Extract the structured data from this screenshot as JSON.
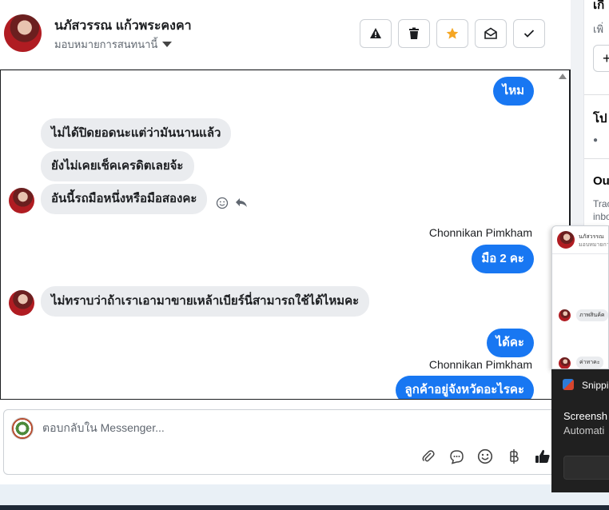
{
  "header": {
    "contact_name": "นภัสวรรณ แก้วพระคงคา",
    "assign_label": "มอบหมายการสนทนานี้",
    "buttons": [
      {
        "name": "spam",
        "icon": "warning-icon"
      },
      {
        "name": "delete",
        "icon": "trash-icon"
      },
      {
        "name": "star",
        "icon": "star-icon"
      },
      {
        "name": "mark-unread",
        "icon": "envelope-open-icon"
      },
      {
        "name": "done",
        "icon": "check-icon"
      }
    ]
  },
  "conversation": {
    "messages": [
      {
        "dir": "out",
        "text": "ไหม"
      },
      {
        "dir": "in",
        "text": "ไม่ได้ปิดยอดนะแต่ว่ามันนานแล้ว"
      },
      {
        "dir": "in",
        "text": "ยังไม่เคยเช็คเครดิตเลยจ้ะ"
      },
      {
        "dir": "in",
        "text": "อันนี้รถมือหนึ่งหรือมือสองคะ"
      },
      {
        "dir": "out",
        "sender": "Chonnikan Pimkham",
        "text": "มือ 2 คะ"
      },
      {
        "dir": "in",
        "text": "ไม่ทราบว่าถ้าเราเอามาขายเหล้าเบียร์นี่สามารถใช้ได้ไหมคะ"
      },
      {
        "dir": "out",
        "text": "ได้คะ"
      },
      {
        "dir": "out",
        "sender": "Chonnikan Pimkham",
        "text": "ลูกค้าอยู่จังหวัดอะไรคะ"
      }
    ]
  },
  "composer": {
    "placeholder": "ตอบกลับใน Messenger...",
    "icons": [
      "paperclip-icon",
      "saved-reply-icon",
      "emoji-icon",
      "baht-icon",
      "thumbs-up-icon"
    ]
  },
  "right_panel": {
    "texts": [
      "เกี",
      "เพิ่",
      "+",
      "โป",
      "Ou",
      "Trac",
      "inbo"
    ]
  },
  "popup": {
    "line1": "นภัสวรรณ",
    "line2": "มอบหมายกา",
    "msg1": "ภาพสินค้ค",
    "msg2": "ค่าทาคะ"
  },
  "toast": {
    "app": "Snippi",
    "title": "Screensh",
    "subtitle": "Automati"
  },
  "colors": {
    "accent": "#1877f2",
    "incoming_bubble": "#eaecef",
    "star": "#f5a623"
  }
}
